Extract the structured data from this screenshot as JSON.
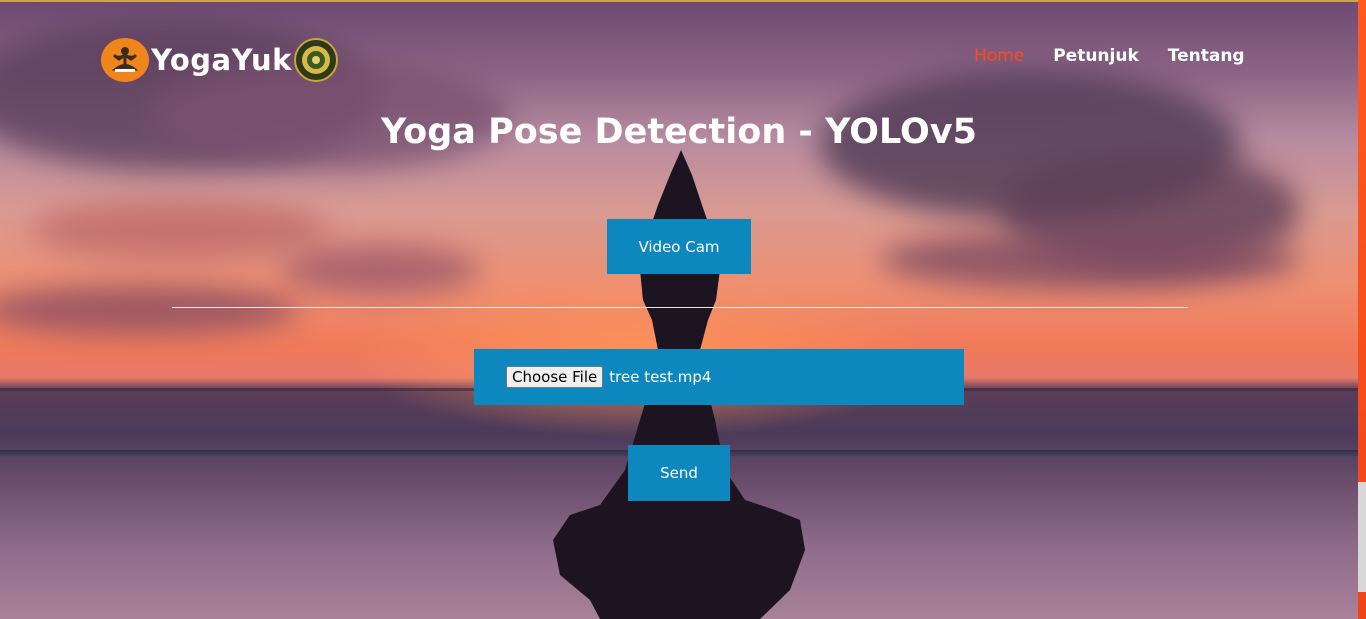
{
  "brand": {
    "name": "YogaYuk",
    "accent_color": "#f0851c"
  },
  "nav": {
    "items": [
      {
        "label": "Home",
        "active": true
      },
      {
        "label": "Petunjuk",
        "active": false
      },
      {
        "label": "Tentang",
        "active": false
      }
    ],
    "active_color": "#ff4a17"
  },
  "main": {
    "title": "Yoga Pose Detection - YOLOv5",
    "video_button_label": "Video Cam",
    "file_input": {
      "button_label": "Choose File",
      "selected_file": "tree test.mp4"
    },
    "send_button_label": "Send",
    "button_color": "#0d88bf"
  },
  "icons": {
    "logo_badge": "yoga-meditation-icon",
    "logo_seal": "university-seal-icon"
  }
}
